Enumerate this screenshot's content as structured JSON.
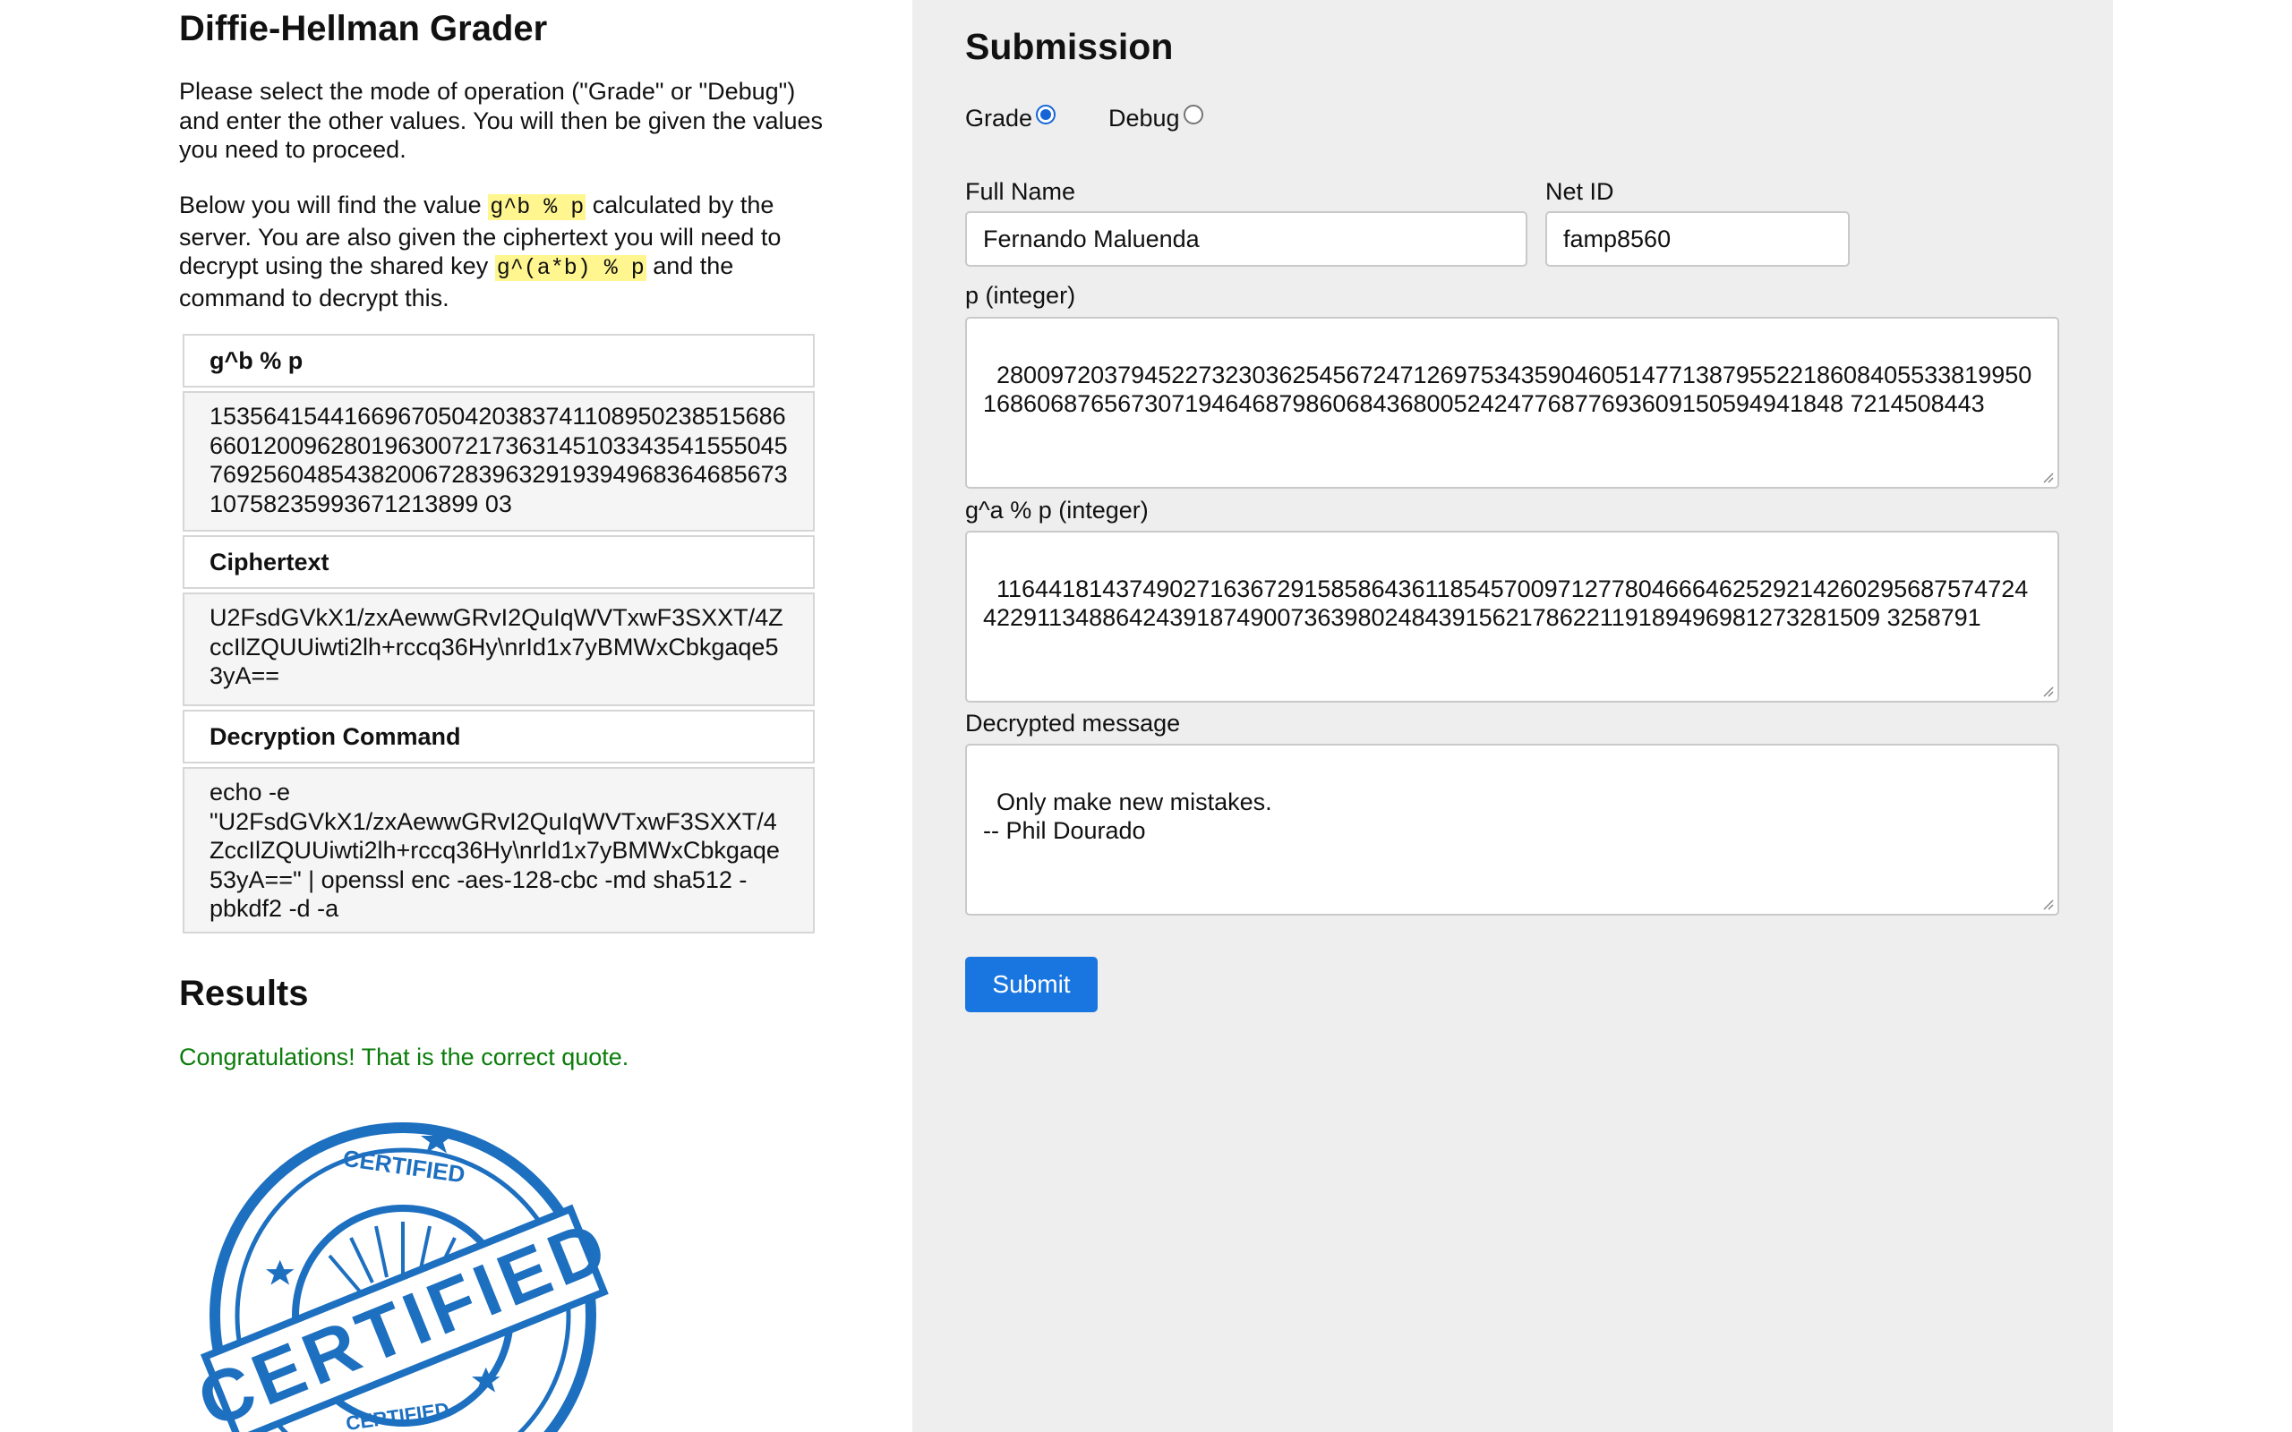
{
  "left": {
    "title": "Diffie-Hellman Grader",
    "intro": "Please select the mode of operation (\"Grade\" or \"Debug\") and enter the other values. You will then be given the values you need to proceed.",
    "desc_part1": "Below you will find the value ",
    "desc_code1": "g^b % p",
    "desc_part2": " calculated by the server. You are also given the ciphertext you will need to decrypt using the shared key ",
    "desc_code2": "g^(a*b) % p",
    "desc_part3": " and the command to decrypt this.",
    "gb_header": "g^b % p",
    "gb_value": "15356415441669670504203837411089502385156866601200962801963007217363145103343541555045769256048543820067283963291939496836468567310758235993671213899 03",
    "cipher_header": "Ciphertext",
    "cipher_value": "U2FsdGVkX1/zxAewwGRvI2QuIqWVTxwF3SXXT/4ZccIlZQUUiwti2lh+rccq36Hy\\nrId1x7yBMWxCbkgaqe53yA==",
    "cmd_header": "Decryption Command",
    "cmd_value": "echo -e \"U2FsdGVkX1/zxAewwGRvI2QuIqWVTxwF3SXXT/4ZccIlZQUUiwti2lh+rccq36Hy\\nrId1x7yBMWxCbkgaqe53yA==\" | openssl enc -aes-128-cbc -md sha512 -pbkdf2 -d -a",
    "results_title": "Results",
    "congrats": "Congratulations! That is the correct quote.",
    "stamp_text": "CERTIFIED",
    "stamp_small_top": "CERTIFIED",
    "stamp_small_bottom": "CERTIFIED"
  },
  "form": {
    "title": "Submission",
    "mode_grade": "Grade",
    "mode_debug": "Debug",
    "selected_mode": "Grade",
    "fullname_label": "Full Name",
    "fullname_value": "Fernando Maluenda",
    "netid_label": "Net ID",
    "netid_value": "famp8560",
    "p_label": "p (integer)",
    "p_value": "280097203794522732303625456724712697534359046051477138795522186084055338199501686068765673071946468798606843680052424776877693609150594941848 7214508443",
    "ga_label": "g^a % p (integer)",
    "ga_value": "116441814374902716367291585864361185457009712778046664625292142602956875747244229113488642439187490073639802484391562178622119189496981273281509 3258791",
    "msg_label": "Decrypted message",
    "msg_value": "Only make new mistakes.\n-- Phil Dourado",
    "submit_label": "Submit"
  },
  "colors": {
    "accent": "#1976e0",
    "success": "#0a7d0a",
    "highlight": "#fff68f",
    "panel_bg": "#eeeeee",
    "stamp_blue": "#1d6fc0"
  }
}
